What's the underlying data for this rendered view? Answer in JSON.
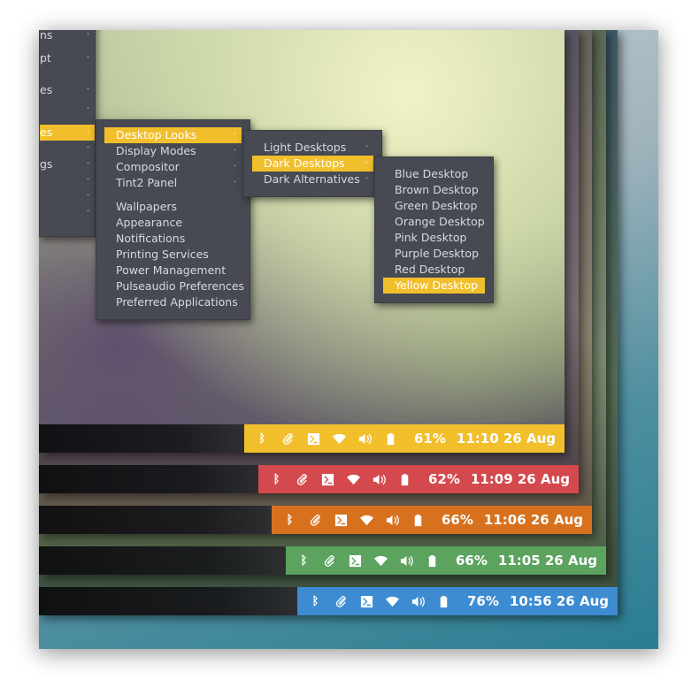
{
  "colors": {
    "yellow": "#f2bf2c",
    "red": "#d4494d",
    "orange": "#d7711e",
    "green": "#5ba35f",
    "blue": "#3d8bd0",
    "menu_bg": "#474a52",
    "menu_text": "#d8d9dc"
  },
  "left_menu": {
    "items": [
      "ns",
      "pt",
      "es",
      "",
      "es",
      "",
      "gs",
      "",
      "",
      ""
    ]
  },
  "menu_main": {
    "items": [
      {
        "label": "Desktop Looks",
        "submenu": true,
        "selected": true
      },
      {
        "label": "Display Modes",
        "submenu": true
      },
      {
        "label": "Compositor",
        "submenu": true
      },
      {
        "label": "Tint2 Panel",
        "submenu": true
      },
      {
        "label": "Wallpapers"
      },
      {
        "label": "Appearance"
      },
      {
        "label": "Notifications"
      },
      {
        "label": "Printing Services"
      },
      {
        "label": "Power Management"
      },
      {
        "label": "Pulseaudio Preferences"
      },
      {
        "label": "Preferred Applications"
      }
    ]
  },
  "menu_looks": {
    "items": [
      {
        "label": "Light Desktops",
        "submenu": true
      },
      {
        "label": "Dark Desktops",
        "submenu": true,
        "selected": true
      },
      {
        "label": "Dark Alternatives",
        "submenu": true
      }
    ]
  },
  "menu_dark": {
    "items": [
      {
        "label": "Blue Desktop"
      },
      {
        "label": "Brown Desktop"
      },
      {
        "label": "Green Desktop"
      },
      {
        "label": "Orange Desktop"
      },
      {
        "label": "Pink Desktop"
      },
      {
        "label": "Purple Desktop"
      },
      {
        "label": "Red Desktop"
      },
      {
        "label": "Yellow Desktop",
        "selected": true
      }
    ]
  },
  "panels": {
    "yellow": {
      "battery": "61%",
      "clock": "11:10 26 Aug"
    },
    "red": {
      "battery": "62%",
      "clock": "11:09 26 Aug"
    },
    "orange": {
      "battery": "66%",
      "clock": "11:06 26 Aug"
    },
    "green": {
      "battery": "66%",
      "clock": "11:05 26 Aug"
    },
    "blue": {
      "battery": "76%",
      "clock": "10:56 26 Aug"
    }
  },
  "tray_icons": [
    "bluetooth-icon",
    "paperclip-icon",
    "terminal-icon",
    "wifi-icon",
    "volume-icon",
    "battery-icon"
  ]
}
